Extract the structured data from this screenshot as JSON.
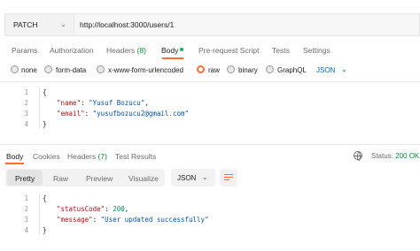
{
  "request": {
    "method": "PATCH",
    "url": "http://localhost:3000/users/1"
  },
  "request_tabs": {
    "params": "Params",
    "authorization": "Authorization",
    "headers": "Headers",
    "headers_count": "(8)",
    "body": "Body",
    "pre_request": "Pre-request Script",
    "tests": "Tests",
    "settings": "Settings"
  },
  "body_types": {
    "none": "none",
    "form_data": "form-data",
    "urlencoded": "x-www-form-urlencoded",
    "raw": "raw",
    "binary": "binary",
    "graphql": "GraphQL",
    "format": "JSON",
    "selected": "raw"
  },
  "request_body": {
    "line_numbers": [
      "1",
      "2",
      "3",
      "4"
    ],
    "open": "{",
    "name_key": "\"name\"",
    "name_val": "\"Yusuf Bozucu\"",
    "email_key": "\"email\"",
    "email_val": "\"yusufbozucu2@gmail.com\"",
    "close": "}"
  },
  "response_tabs": {
    "body": "Body",
    "cookies": "Cookies",
    "headers": "Headers",
    "headers_count": "(7)",
    "test_results": "Test Results",
    "status_label": "Status:",
    "status_value": "200 OK"
  },
  "response_toolbar": {
    "pretty": "Pretty",
    "raw": "Raw",
    "preview": "Preview",
    "visualize": "Visualize",
    "format": "JSON"
  },
  "response_body": {
    "line_numbers": [
      "1",
      "2",
      "3",
      "4"
    ],
    "open": "{",
    "status_key": "\"statusCode\"",
    "status_val": "200",
    "message_key": "\"message\"",
    "message_val": "\"User updated successfully\"",
    "close": "}"
  },
  "colors": {
    "accent": "#ff6c37",
    "success": "#0a8a3a",
    "link": "#0265d2"
  }
}
